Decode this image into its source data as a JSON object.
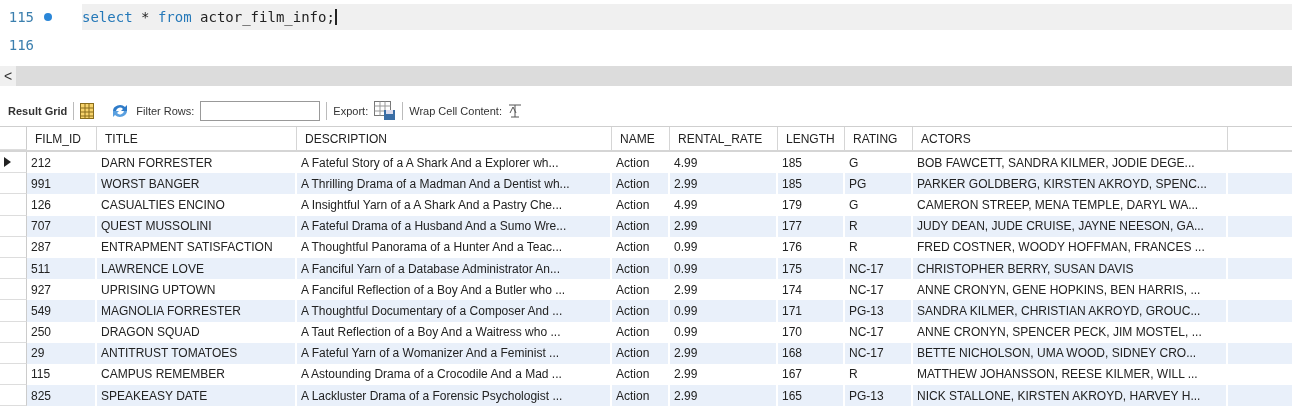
{
  "editor": {
    "lines": [
      {
        "number": "115",
        "marker": true,
        "current": true,
        "tokens": [
          {
            "kind": "keyword",
            "text": "select"
          },
          {
            "kind": "plain",
            "text": " * "
          },
          {
            "kind": "keyword",
            "text": "from"
          },
          {
            "kind": "plain",
            "text": " actor_film_info;"
          }
        ]
      },
      {
        "number": "116",
        "marker": false,
        "current": false
      }
    ]
  },
  "scroll_arrow": "<",
  "toolbar": {
    "result_grid": "Result Grid",
    "filter_label": "Filter Rows:",
    "export_label": "Export:",
    "wrap_label": "Wrap Cell Content:"
  },
  "table": {
    "columns": [
      "FILM_ID",
      "TITLE",
      "DESCRIPTION",
      "NAME",
      "RENTAL_RATE",
      "LENGTH",
      "RATING",
      "ACTORS"
    ],
    "rows": [
      {
        "selected": true,
        "cells": [
          "212",
          "DARN FORRESTER",
          "A Fateful Story of a A Shark And a Explorer wh...",
          "Action",
          "4.99",
          "185",
          "G",
          "BOB FAWCETT, SANDRA KILMER, JODIE DEGE..."
        ]
      },
      {
        "selected": false,
        "cells": [
          "991",
          "WORST BANGER",
          "A Thrilling Drama of a Madman And a Dentist wh...",
          "Action",
          "2.99",
          "185",
          "PG",
          "PARKER GOLDBERG, KIRSTEN AKROYD, SPENC..."
        ]
      },
      {
        "selected": false,
        "cells": [
          "126",
          "CASUALTIES ENCINO",
          "A Insightful Yarn of a A Shark And a Pastry Che...",
          "Action",
          "4.99",
          "179",
          "G",
          "CAMERON STREEP, MENA TEMPLE, DARYL WA..."
        ]
      },
      {
        "selected": false,
        "cells": [
          "707",
          "QUEST MUSSOLINI",
          "A Fateful Drama of a Husband And a Sumo Wre...",
          "Action",
          "2.99",
          "177",
          "R",
          "JUDY DEAN, JUDE CRUISE, JAYNE NEESON, GA..."
        ]
      },
      {
        "selected": false,
        "cells": [
          "287",
          "ENTRAPMENT SATISFACTION",
          "A Thoughtful Panorama of a Hunter And a Teac...",
          "Action",
          "0.99",
          "176",
          "R",
          "FRED COSTNER, WOODY HOFFMAN, FRANCES ..."
        ]
      },
      {
        "selected": false,
        "cells": [
          "511",
          "LAWRENCE LOVE",
          "A Fanciful Yarn of a Database Administrator An...",
          "Action",
          "0.99",
          "175",
          "NC-17",
          "CHRISTOPHER BERRY, SUSAN DAVIS"
        ]
      },
      {
        "selected": false,
        "cells": [
          "927",
          "UPRISING UPTOWN",
          "A Fanciful Reflection of a Boy And a Butler who ...",
          "Action",
          "2.99",
          "174",
          "NC-17",
          "ANNE CRONYN, GENE HOPKINS, BEN HARRIS, ..."
        ]
      },
      {
        "selected": false,
        "cells": [
          "549",
          "MAGNOLIA FORRESTER",
          "A Thoughtful Documentary of a Composer And ...",
          "Action",
          "0.99",
          "171",
          "PG-13",
          "SANDRA KILMER, CHRISTIAN AKROYD, GROUC..."
        ]
      },
      {
        "selected": false,
        "cells": [
          "250",
          "DRAGON SQUAD",
          "A Taut Reflection of a Boy And a Waitress who ...",
          "Action",
          "0.99",
          "170",
          "NC-17",
          "ANNE CRONYN, SPENCER PECK, JIM MOSTEL, ..."
        ]
      },
      {
        "selected": false,
        "cells": [
          "29",
          "ANTITRUST TOMATOES",
          "A Fateful Yarn of a Womanizer And a Feminist ...",
          "Action",
          "2.99",
          "168",
          "NC-17",
          "BETTE NICHOLSON, UMA WOOD, SIDNEY CRO..."
        ]
      },
      {
        "selected": false,
        "cells": [
          "115",
          "CAMPUS REMEMBER",
          "A Astounding Drama of a Crocodile And a Mad ...",
          "Action",
          "2.99",
          "167",
          "R",
          "MATTHEW JOHANSSON, REESE KILMER, WILL ..."
        ]
      },
      {
        "selected": false,
        "cells": [
          "825",
          "SPEAKEASY DATE",
          "A Lackluster Drama of a Forensic Psychologist ...",
          "Action",
          "2.99",
          "165",
          "PG-13",
          "NICK STALLONE, KIRSTEN AKROYD, HARVEY H..."
        ]
      }
    ]
  }
}
